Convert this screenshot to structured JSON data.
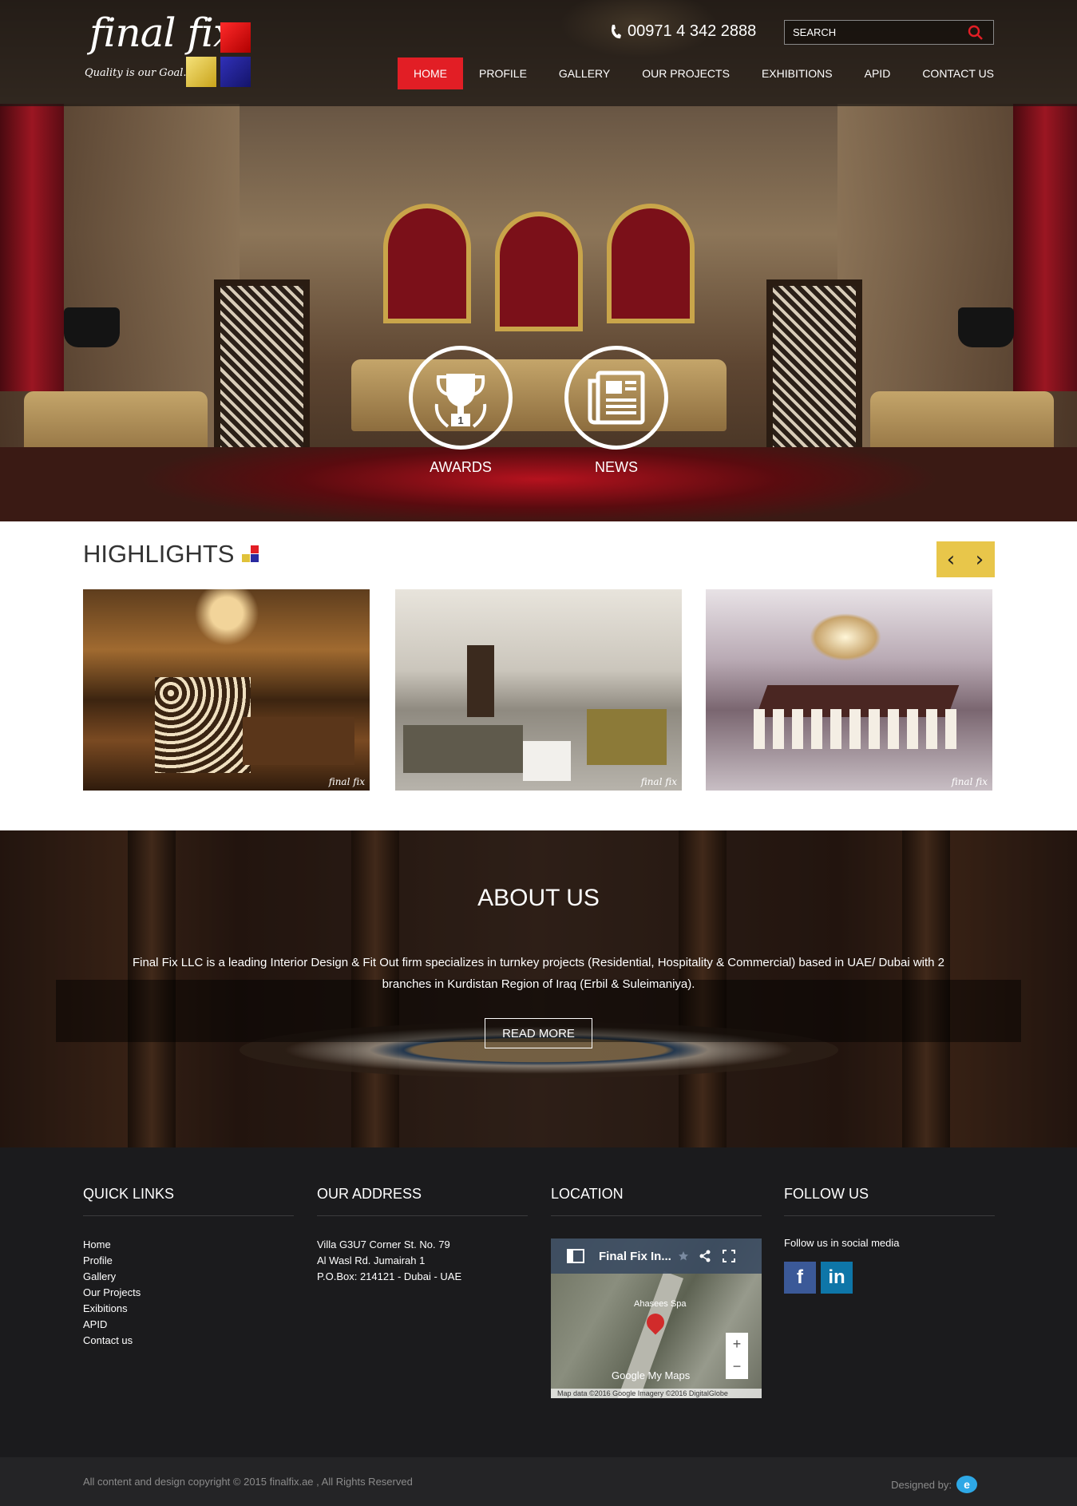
{
  "brand": {
    "name": "final fix",
    "tagline": "Quality is our Goal..."
  },
  "header": {
    "phone": "00971 4 342 2888",
    "search_placeholder": "SEARCH"
  },
  "nav": [
    {
      "label": "HOME",
      "active": true
    },
    {
      "label": "PROFILE",
      "active": false
    },
    {
      "label": "GALLERY",
      "active": false
    },
    {
      "label": "OUR PROJECTS",
      "active": false
    },
    {
      "label": "EXHIBITIONS",
      "active": false
    },
    {
      "label": "APID",
      "active": false
    },
    {
      "label": "CONTACT US",
      "active": false
    }
  ],
  "features": [
    {
      "label": "AWARDS",
      "icon": "trophy-icon"
    },
    {
      "label": "NEWS",
      "icon": "newspaper-icon"
    }
  ],
  "highlights": {
    "title": "HIGHLIGHTS",
    "watermark": "final fix"
  },
  "about": {
    "title": "ABOUT US",
    "text": "Final Fix LLC is a leading Interior Design & Fit Out firm specializes in turnkey projects (Residential, Hospitality & Commercial) based in UAE/ Dubai with 2 branches in Kurdistan Region of Iraq (Erbil & Suleimaniya).",
    "button": "READ MORE"
  },
  "footer": {
    "quick_links": {
      "title": "QUICK LINKS",
      "items": [
        "Home",
        "Profile",
        "Gallery",
        "Our Projects",
        "Exibitions",
        "APID",
        "Contact us"
      ]
    },
    "address": {
      "title": "OUR ADDRESS",
      "lines": [
        "Villa G3U7 Corner St. No. 79",
        "Al Wasl Rd. Jumairah 1",
        "P.O.Box: 214121 - Dubai - UAE"
      ]
    },
    "location": {
      "title": "LOCATION",
      "map_title": "Final Fix In...",
      "place": "Ahasees Spa",
      "google": "Google My Maps",
      "credit": "Map data ©2016 Google Imagery ©2016 DigitalGlobe"
    },
    "follow": {
      "title": "FOLLOW US",
      "text": "Follow us in social media"
    }
  },
  "copyright": {
    "text": "All content and design copyright © 2015 finalfix.ae , All Rights Reserved",
    "designed_by": "Designed by:"
  },
  "colors": {
    "accent_red": "#e21e25",
    "arrow_yellow": "#e8c64a",
    "footer_bg": "#1b1b1d"
  }
}
